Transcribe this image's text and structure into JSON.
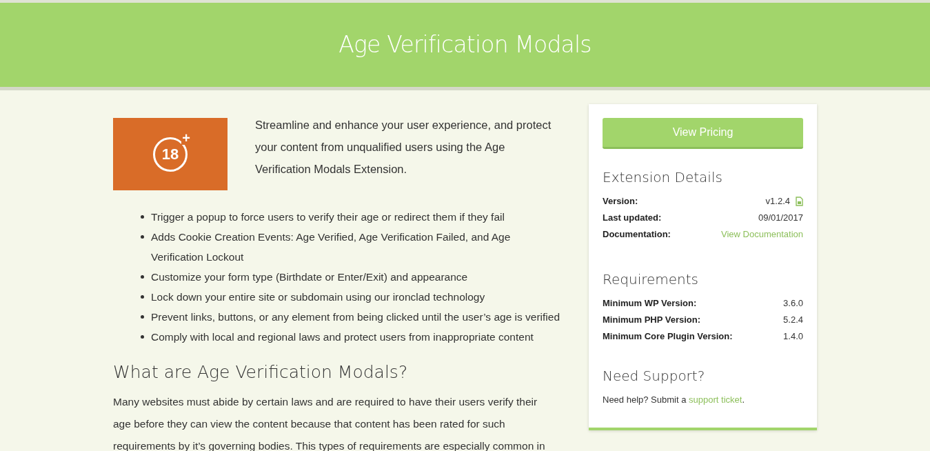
{
  "header": {
    "title": "Age Verification Modals"
  },
  "intro": {
    "badge": {
      "number": "18",
      "plus": "+"
    },
    "text": "Streamline and enhance your user experience, and protect your content from unqualified users using the Age Verification Modals Extension."
  },
  "features": [
    "Trigger a popup to force users to verify their age or redirect them if they fail",
    "Adds Cookie Creation Events: Age Verified, Age Verification Failed, and Age Verification Lockout",
    "Customize your form type (Birthdate or Enter/Exit) and appearance",
    "Lock down your entire site or subdomain using our ironclad technology",
    "Prevent links, buttons, or any element from being clicked until the user’s age is verified",
    "Comply with local and regional laws and protect users from inappropriate content"
  ],
  "section": {
    "heading": "What are Age Verification Modals?",
    "lines": [
      "Many websites must abide by certain laws and are required to have their users verify their",
      "age before they can view the content because that content has been rated for such",
      "requirements by it’s governing bodies. This types of requirements are especially common in"
    ]
  },
  "sidebar": {
    "button": "View Pricing",
    "details": {
      "heading": "Extension Details",
      "rows": [
        {
          "label": "Version:",
          "value": "v1.2.4",
          "kind": "file"
        },
        {
          "label": "Last updated:",
          "value": "09/01/2017",
          "kind": "text"
        },
        {
          "label": "Documentation:",
          "value": "View Documentation",
          "kind": "link"
        }
      ]
    },
    "requirements": {
      "heading": "Requirements",
      "rows": [
        {
          "label": "Minimum WP Version:",
          "value": "3.6.0",
          "kind": "text"
        },
        {
          "label": "Minimum PHP Version:",
          "value": "5.2.4",
          "kind": "text"
        },
        {
          "label": "Minimum Core Plugin Version:",
          "value": "1.4.0",
          "kind": "text"
        }
      ]
    },
    "support": {
      "heading": "Need Support?",
      "text": "Need help? Submit a",
      "link": "support ticket",
      "after": "."
    }
  }
}
